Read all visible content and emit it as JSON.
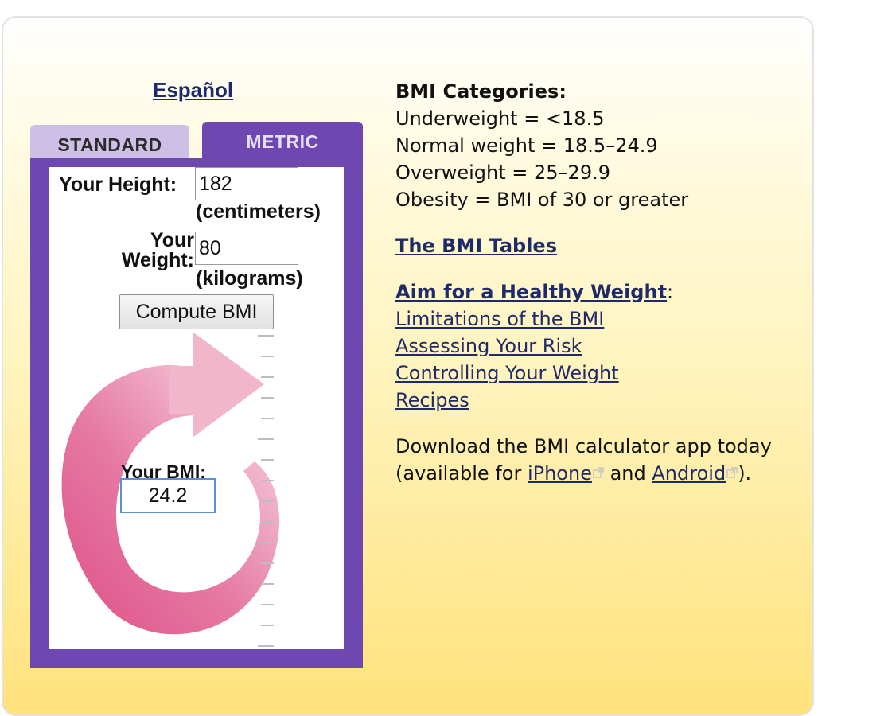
{
  "calculator": {
    "language_link": "Español",
    "tabs": [
      {
        "label": "STANDARD",
        "active": false
      },
      {
        "label": "METRIC",
        "active": true
      }
    ],
    "height": {
      "label": "Your Height:",
      "value": "182",
      "unit": "(centimeters)"
    },
    "weight": {
      "label_line1": "Your",
      "label_line2": "Weight:",
      "value": "80",
      "unit": "(kilograms)"
    },
    "compute_button": "Compute BMI",
    "result": {
      "label": "Your BMI:",
      "value": "24.2"
    }
  },
  "categories": {
    "heading": "BMI Categories:",
    "items": [
      "Underweight = <18.5",
      "Normal weight = 18.5–24.9",
      "Overweight = 25–29.9",
      "Obesity = BMI of 30 or greater"
    ]
  },
  "links": {
    "bmi_tables": "The BMI Tables",
    "healthy_weight": "Aim for a Healthy Weight",
    "healthy_weight_suffix": ":",
    "sub_items": [
      "Limitations of the BMI",
      "Assessing Your Risk",
      "Controlling Your Weight",
      "Recipes"
    ]
  },
  "app_promo": {
    "line1": "Download the BMI calculator app today",
    "prefix": "(available for ",
    "iphone": "iPhone",
    "middle": " and ",
    "android": "Android",
    "suffix": ")."
  },
  "colors": {
    "tab_active": "#6e47b0",
    "tab_inactive": "#cdbfe6",
    "link": "#1f2a6b",
    "arrow": "#e0568a",
    "card_bottom": "#ffe27c"
  },
  "icons": {
    "external_link": "external-link-icon",
    "dial_arrow": "circular-arrow-icon"
  }
}
